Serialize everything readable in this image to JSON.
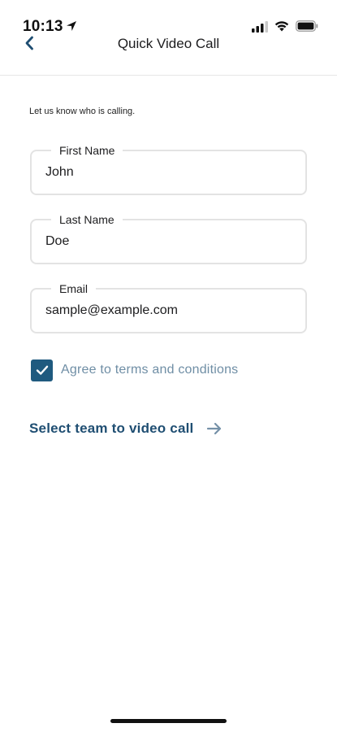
{
  "status_bar": {
    "time": "10:13",
    "location_icon": "location-arrow-icon",
    "signal_icon": "cellular-signal-icon",
    "wifi_icon": "wifi-icon",
    "battery_icon": "battery-icon"
  },
  "header": {
    "back_icon": "chevron-left-icon",
    "title": "Quick Video Call"
  },
  "form": {
    "intro": "Let us know who is calling.",
    "first_name": {
      "label": "First Name",
      "value": "John"
    },
    "last_name": {
      "label": "Last Name",
      "value": "Doe"
    },
    "email": {
      "label": "Email",
      "value": "sample@example.com"
    },
    "terms": {
      "label": "Agree to terms and conditions",
      "checked": true
    }
  },
  "cta": {
    "label": "Select team to video call",
    "icon": "arrow-right-icon"
  },
  "colors": {
    "accent": "#1f4e72",
    "checkbox": "#1f5a7f",
    "muted_text": "#6f8ea5",
    "field_border": "#e3e3e3"
  }
}
